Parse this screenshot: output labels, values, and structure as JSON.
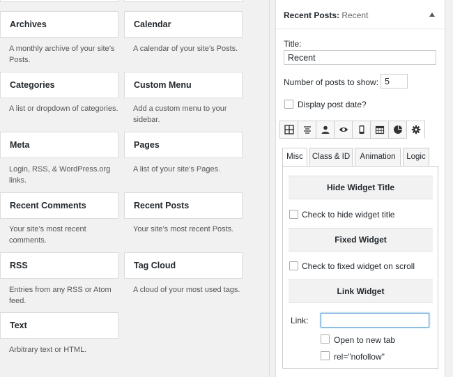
{
  "widgets": [
    {
      "title": "Archives",
      "desc": "A monthly archive of your site’s Posts."
    },
    {
      "title": "Calendar",
      "desc": "A calendar of your site’s Posts."
    },
    {
      "title": "Categories",
      "desc": "A list or dropdown of categories."
    },
    {
      "title": "Custom Menu",
      "desc": "Add a custom menu to your sidebar."
    },
    {
      "title": "Meta",
      "desc": "Login, RSS, & WordPress.org links."
    },
    {
      "title": "Pages",
      "desc": "A list of your site’s Pages."
    },
    {
      "title": "Recent Comments",
      "desc": "Your site’s most recent comments."
    },
    {
      "title": "Recent Posts",
      "desc": "Your site’s most recent Posts."
    },
    {
      "title": "RSS",
      "desc": "Entries from any RSS or Atom feed."
    },
    {
      "title": "Tag Cloud",
      "desc": "A cloud of your most used tags."
    },
    {
      "title": "Text",
      "desc": "Arbitrary text or HTML."
    }
  ],
  "panel": {
    "header_bold": "Recent Posts:",
    "header_name": "Recent",
    "title_label": "Title:",
    "title_value": "Recent",
    "num_posts_label": "Number of posts to show:",
    "num_posts_value": "5",
    "display_date_label": "Display post date?"
  },
  "icon_tabs": [
    "grid-icon",
    "align-center-icon",
    "user-icon",
    "eye-icon",
    "mobile-icon",
    "calendar-icon",
    "palette-icon",
    "gear-icon"
  ],
  "tabs": [
    "Misc",
    "Class & ID",
    "Animation",
    "Logic"
  ],
  "misc": {
    "hide_title_header": "Hide Widget Title",
    "hide_title_check": "Check to hide widget title",
    "fixed_header": "Fixed Widget",
    "fixed_check": "Check to fixed widget on scroll",
    "link_header": "Link Widget",
    "link_label": "Link:",
    "link_value": "",
    "new_tab": "Open to new tab",
    "nofollow": "rel=\"nofollow\""
  }
}
